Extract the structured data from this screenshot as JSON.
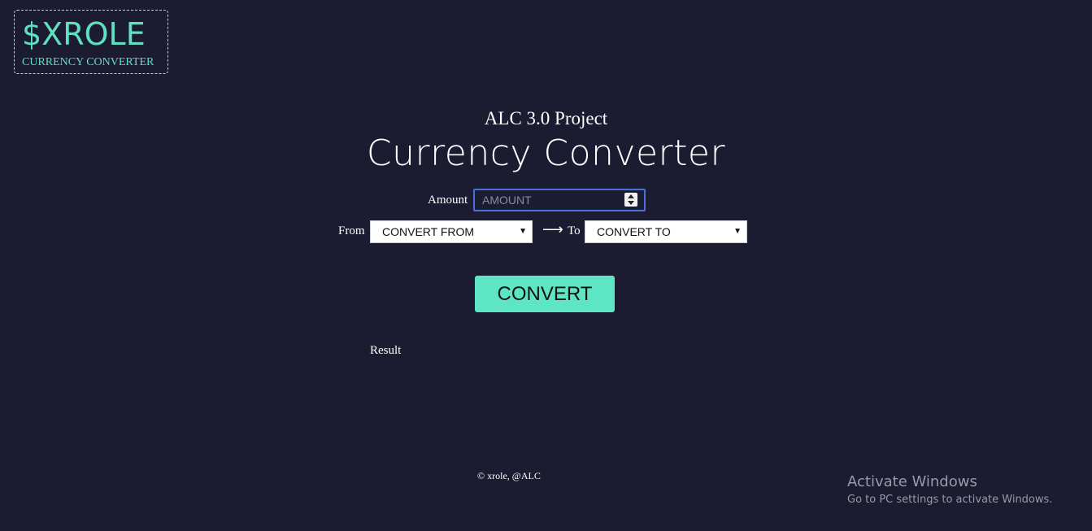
{
  "logo": {
    "title": "$XROLE",
    "subtitle": "CURRENCY CONVERTER"
  },
  "header": {
    "project": "ALC 3.0 Project",
    "title": "Currency Converter"
  },
  "form": {
    "amount_label": "Amount",
    "amount_placeholder": "AMOUNT",
    "from_label": "From",
    "from_selected": "CONVERT FROM",
    "arrow": "⟶",
    "to_label": "To",
    "to_selected": "CONVERT TO",
    "convert_label": "CONVERT",
    "result_label": "Result"
  },
  "footer": {
    "text": "© xrole, @ALC"
  },
  "watermark": {
    "title": "Activate Windows",
    "subtitle": "Go to PC settings to activate Windows."
  },
  "colors": {
    "background": "#1b1b31",
    "accent": "#5ee6c4",
    "input_border": "#4a6fd9"
  },
  "icons": {
    "spinner": "number-spinner-icon",
    "dropdown": "dropdown-triangle-icon",
    "arrow": "right-arrow-icon"
  }
}
